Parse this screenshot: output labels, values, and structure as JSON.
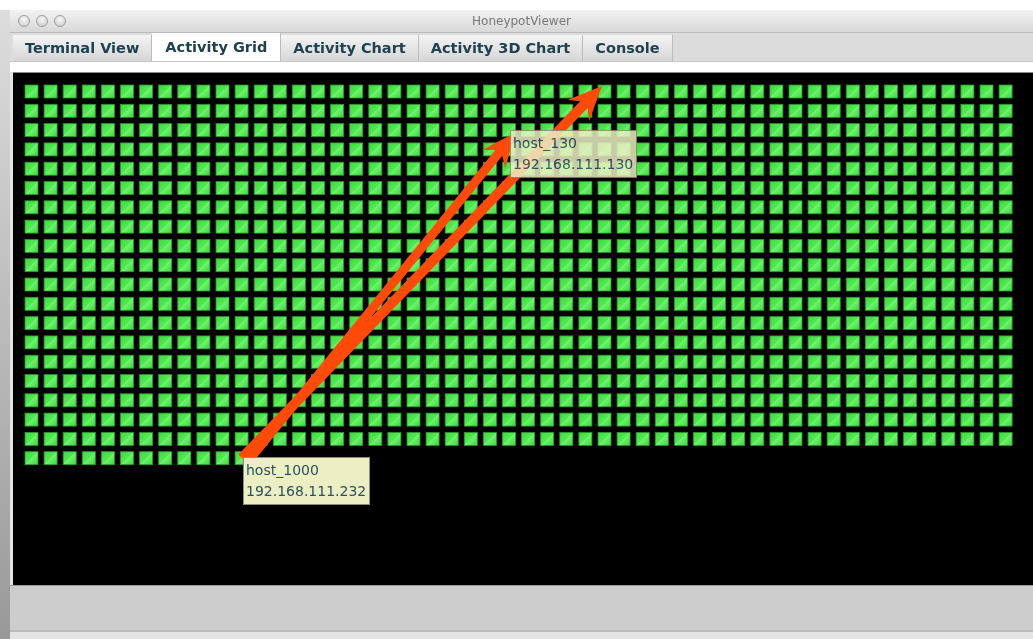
{
  "window": {
    "title": "HoneypotViewer"
  },
  "tabs": [
    {
      "label": "Terminal View",
      "selected": false
    },
    {
      "label": "Activity Grid",
      "selected": true
    },
    {
      "label": "Activity Chart",
      "selected": false
    },
    {
      "label": "Activity 3D Chart",
      "selected": false
    },
    {
      "label": "Console",
      "selected": false
    }
  ],
  "host_labels": [
    {
      "name": "host_130",
      "address": "192.168.111.130"
    },
    {
      "name": "host_1000",
      "address": "192.168.111.232"
    }
  ]
}
